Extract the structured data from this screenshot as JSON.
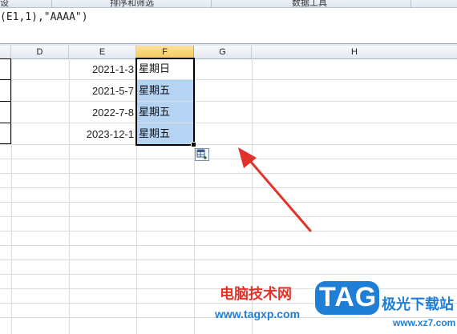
{
  "ribbon": {
    "groups": [
      "设",
      "排序和筛选",
      "数据工具",
      ""
    ]
  },
  "formula_bar": {
    "text": "(E1,1),\"AAAA\")"
  },
  "columns": [
    "D",
    "E",
    "F",
    "G",
    "H"
  ],
  "selected_column": "F",
  "rows": [
    {
      "date": "2021-1-3",
      "weekday": "星期日"
    },
    {
      "date": "2021-5-7",
      "weekday": "星期五"
    },
    {
      "date": "2022-7-8",
      "weekday": "星期五"
    },
    {
      "date": "2023-12-1",
      "weekday": "星期五"
    }
  ],
  "paste_options_icon": "paste-options-icon",
  "annotation": {
    "color": "#e0342a"
  },
  "watermark": {
    "site_name": "电脑技术网",
    "site_url": "www.tagxp.com",
    "logo_text": "TAG",
    "brand_text": "极光下载站",
    "brand_url": "www.xz7.com",
    "colors": {
      "red": "#e0342a",
      "blue": "#1f7ed6"
    }
  }
}
